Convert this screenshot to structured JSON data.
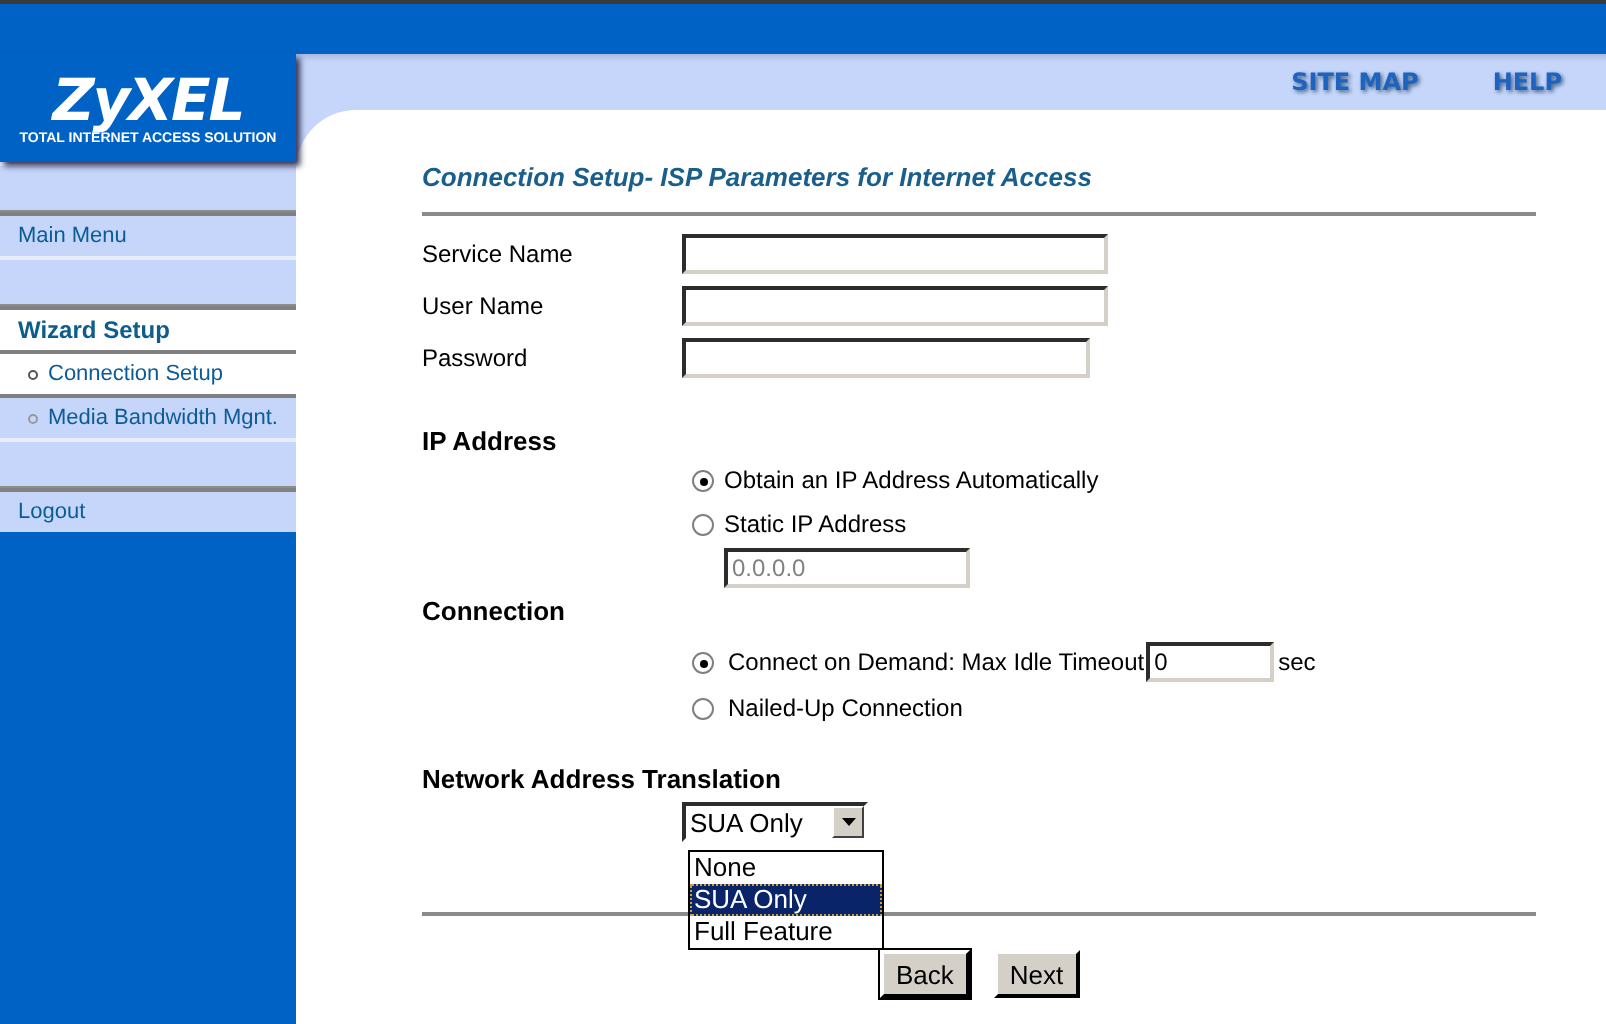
{
  "logo": {
    "name": "ZyXEL",
    "tagline": "TOTAL INTERNET ACCESS SOLUTION"
  },
  "top_links": [
    "SITE MAP",
    "HELP"
  ],
  "sidebar": {
    "groups": [
      [
        {
          "kind": "link",
          "label": "Main Menu"
        }
      ],
      [
        {
          "kind": "heading",
          "label": "Wizard Setup"
        },
        {
          "kind": "sub",
          "label": "Connection Setup",
          "selected": true
        },
        {
          "kind": "sub",
          "label": "Media Bandwidth Mgnt.",
          "selected": false
        }
      ],
      [
        {
          "kind": "link",
          "label": "Logout"
        }
      ]
    ]
  },
  "form": {
    "title": "Connection Setup- ISP Parameters for Internet Access",
    "fields": [
      {
        "label": "Service Name"
      },
      {
        "label": "User Name"
      },
      {
        "label": "Password"
      }
    ],
    "ip_address": {
      "heading": "IP Address",
      "options": [
        {
          "label": "Obtain an IP Address Automatically",
          "selected": true
        },
        {
          "label": "Static IP Address",
          "selected": false
        }
      ],
      "static_ip": {
        "value": "0.0.0.0",
        "disabled": true
      }
    },
    "connection": {
      "heading": "Connection",
      "options": [
        {
          "label": "Connect on Demand: Max Idle Timeout",
          "selected": true,
          "timeout": "0",
          "unit": "sec"
        },
        {
          "label": "Nailed-Up Connection",
          "selected": false
        }
      ]
    },
    "nat": {
      "heading": "Network Address Translation",
      "select": {
        "value": "SUA Only",
        "expanded": true,
        "options": [
          {
            "label": "None",
            "selected": false
          },
          {
            "label": "SUA Only",
            "selected": true
          },
          {
            "label": "Full Feature",
            "selected": false
          }
        ]
      }
    },
    "buttons": [
      "Back",
      "Next"
    ]
  }
}
